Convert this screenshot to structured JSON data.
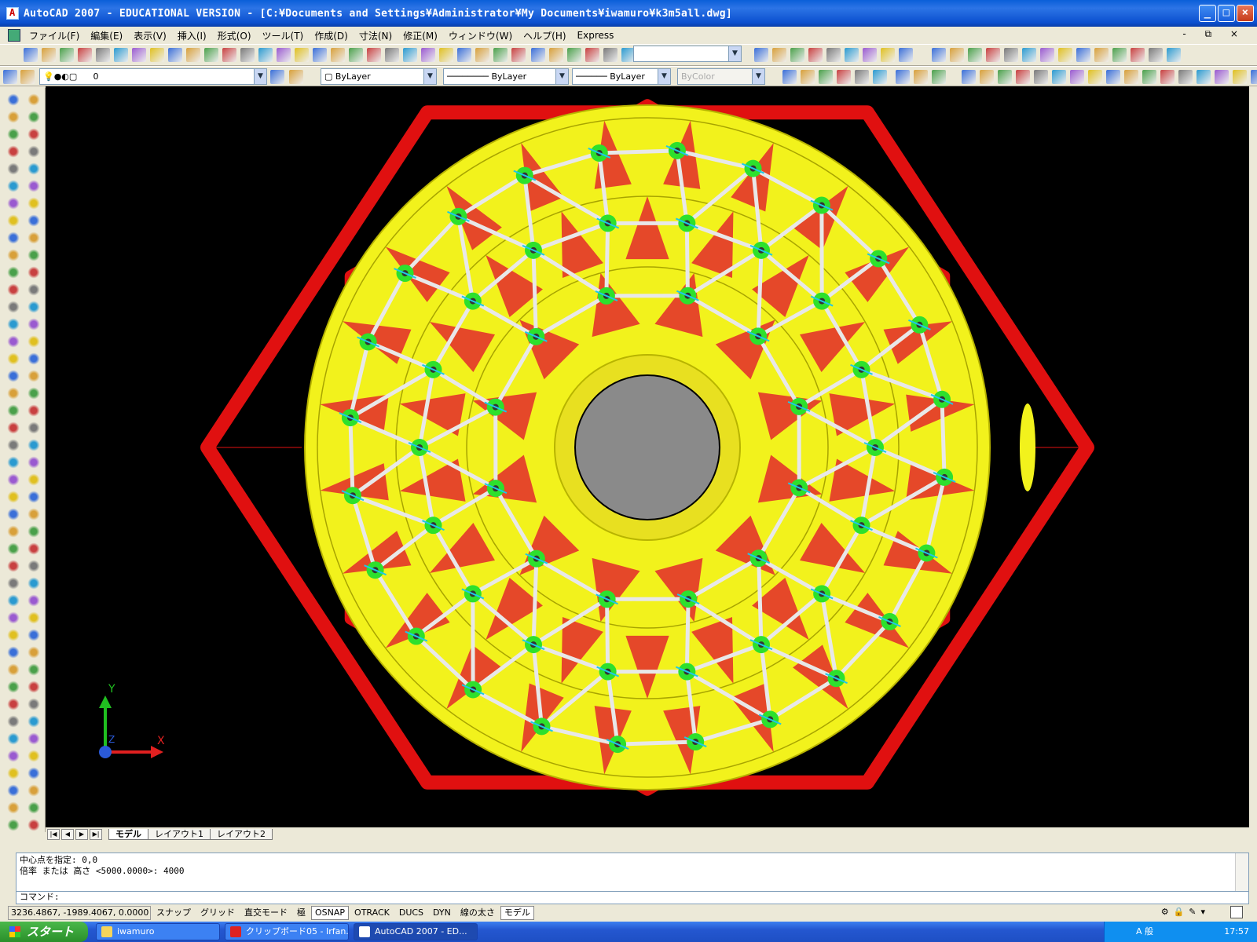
{
  "window": {
    "title": "AutoCAD 2007 - EDUCATIONAL VERSION - [C:¥Documents and Settings¥Administrator¥My Documents¥iwamuro¥k3m5all.dwg]",
    "min": "_",
    "max": "□",
    "close": "×"
  },
  "menu": {
    "items": [
      "ファイル(F)",
      "編集(E)",
      "表示(V)",
      "挿入(I)",
      "形式(O)",
      "ツール(T)",
      "作成(D)",
      "寸法(N)",
      "修正(M)",
      "ウィンドウ(W)",
      "ヘルプ(H)",
      "Express"
    ],
    "mdi": "- ⧉ ×"
  },
  "layers": {
    "layer_value": "0",
    "color": "ByLayer",
    "linetype": "ByLayer",
    "lineweight": "ByLayer",
    "plotstyle": "ByColor"
  },
  "tabs": [
    "モデル",
    "レイアウト1",
    "レイアウト2"
  ],
  "command": {
    "line1": "中心点を指定: 0,0",
    "line2": "倍率 または 高さ <5000.0000>: 4000",
    "prompt": "コマンド:"
  },
  "status": {
    "coords": "3236.4867, -1989.4067, 0.0000",
    "buttons": [
      "スナップ",
      "グリッド",
      "直交モード",
      "極",
      "OSNAP",
      "OTRACK",
      "DUCS",
      "DYN",
      "線の太さ",
      "モデル"
    ],
    "on": [
      "OSNAP",
      "モデル"
    ]
  },
  "ucs": {
    "y": "Y",
    "x": "X",
    "z": "Z"
  },
  "taskbar": {
    "start": "スタート",
    "tasks": [
      "iwamuro",
      "クリップボード05 - Irfan...",
      "AutoCAD 2007 - ED..."
    ],
    "ime": "A 般",
    "clock": "17:57"
  },
  "colors": {
    "frame": "#e01010",
    "disc": "#f2f21c",
    "panel": "#e43a2a",
    "node": "#2de02d",
    "strut": "#e8e8e8",
    "hub": "#8a8a8a"
  }
}
